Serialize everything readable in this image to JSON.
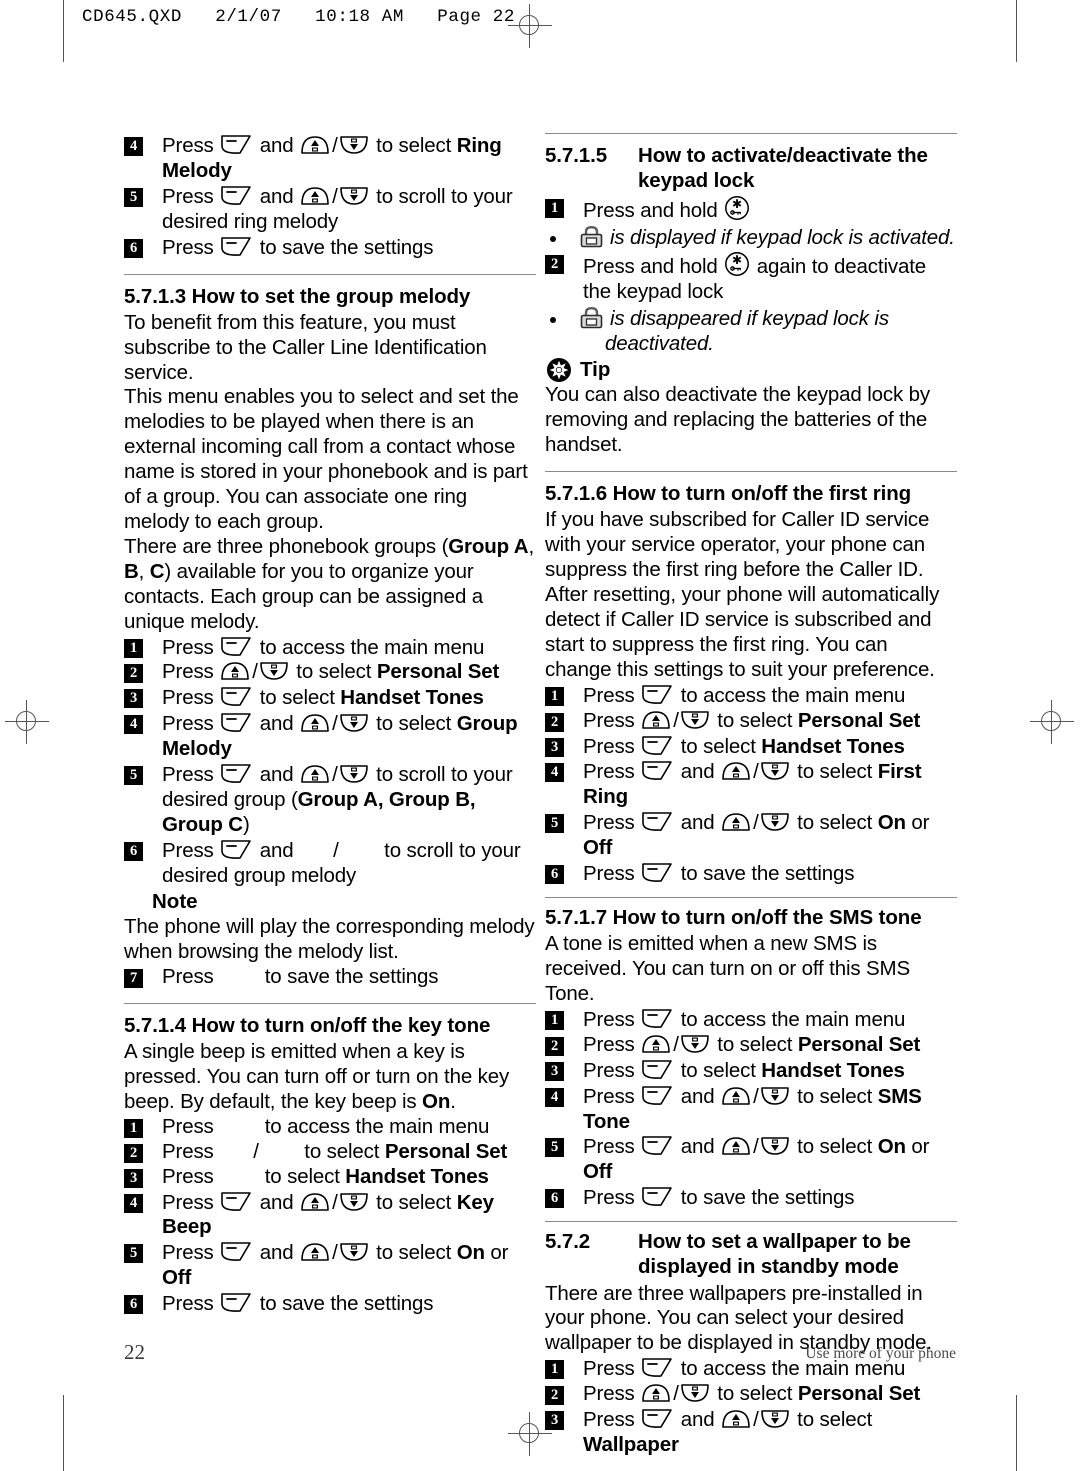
{
  "file_header": "CD645.QXD   2/1/07   10:18 AM   Page 22",
  "footer": {
    "page_number": "22",
    "running_title": "Use more of your phone"
  },
  "icons": {
    "softkey": "softkey-icon",
    "scroll_up": "scroll-up-icon",
    "scroll_down": "scroll-down-icon",
    "star_key": "star-key-icon",
    "padlock": "padlock-icon",
    "tip": "tip-asterisk-icon"
  },
  "left_column": {
    "ring_melody_steps": [
      {
        "num": "4",
        "parts": [
          {
            "t": "text",
            "v": "Press "
          },
          {
            "t": "icon",
            "v": "softkey"
          },
          {
            "t": "text",
            "v": " and "
          },
          {
            "t": "icon",
            "v": "scrollpair"
          },
          {
            "t": "text",
            "v": " to select "
          },
          {
            "t": "bold",
            "v": "Ring Melody"
          }
        ]
      },
      {
        "num": "5",
        "parts": [
          {
            "t": "text",
            "v": "Press "
          },
          {
            "t": "icon",
            "v": "softkey"
          },
          {
            "t": "text",
            "v": " and "
          },
          {
            "t": "icon",
            "v": "scrollpair"
          },
          {
            "t": "text",
            "v": " to scroll to your desired ring melody"
          }
        ]
      },
      {
        "num": "6",
        "parts": [
          {
            "t": "text",
            "v": "Press "
          },
          {
            "t": "icon",
            "v": "softkey"
          },
          {
            "t": "text",
            "v": " to save the settings"
          }
        ]
      }
    ],
    "section_5713": {
      "number": "5.7.1.3",
      "title": "How to set the group melody",
      "paragraphs": [
        "To benefit from this feature, you must subscribe to the Caller Line Identification service.",
        "This menu enables you to select and set the melodies to be played when there is an external incoming call from a contact whose name is stored in your phonebook and is part of a group. You can associate one ring melody to each group."
      ],
      "groups_intro_before": "There are three phonebook groups (",
      "groups_bold_1": "Group A",
      "groups_mid_1": ", ",
      "groups_bold_2": "B",
      "groups_mid_2": ", ",
      "groups_bold_3": "C",
      "groups_intro_after": ") available for you to organize your contacts. Each group can be assigned a unique melody.",
      "steps": [
        {
          "num": "1",
          "pre": "Press ",
          "icon": "softkey",
          "post": " to access the main menu",
          "bold": ""
        },
        {
          "num": "2",
          "pre": "Press ",
          "icon": "scrollpair",
          "post": " to select ",
          "bold": "Personal Set"
        },
        {
          "num": "3",
          "pre": "Press ",
          "icon": "softkey",
          "post": " to select ",
          "bold": "Handset Tones"
        },
        {
          "num": "4",
          "pre": "Press ",
          "icon": "softkey-and-scrollpair",
          "post": " to select ",
          "bold": "Group Melody"
        },
        {
          "num": "5",
          "pre": "Press ",
          "icon": "softkey-and-scrollpair",
          "post": " to scroll to your desired group (",
          "bold": "Group A, Group B, Group C",
          "tail": ")"
        },
        {
          "num": "6",
          "pre": "Press ",
          "icon": "softkey-and-missing",
          "post": " to scroll to your desired group melody",
          "bold": ""
        }
      ],
      "note_heading": "Note",
      "note_text": "The phone will play the corresponding melody when browsing the melody list.",
      "final_step": {
        "num": "7",
        "pre": "Press ",
        "icon": "missing",
        "post": " to save the settings"
      }
    },
    "section_5714": {
      "number": "5.7.1.4",
      "title": "How to turn on/off the key tone",
      "intro_a": "A single beep is emitted when a key is pressed. You can turn off or turn on the key beep. By default, the key beep is ",
      "intro_bold": "On",
      "intro_b": ".",
      "steps": [
        {
          "num": "1",
          "pre": "Press ",
          "icon": "missing",
          "post": " to access the main menu",
          "bold": ""
        },
        {
          "num": "2",
          "pre": "Press ",
          "icon": "missing-slash",
          "post": " to select ",
          "bold": "Personal Set"
        },
        {
          "num": "3",
          "pre": "Press ",
          "icon": "missing",
          "post": " to select ",
          "bold": "Handset Tones"
        },
        {
          "num": "4",
          "pre": "Press ",
          "icon": "softkey-and-scrollpair",
          "post": " to select ",
          "bold": "Key Beep"
        },
        {
          "num": "5",
          "pre": "Press ",
          "icon": "softkey-and-scrollpair",
          "post": " to select ",
          "bold": "On",
          "mid": " or ",
          "bold2": "Off"
        },
        {
          "num": "6",
          "pre": "Press ",
          "icon": "softkey",
          "post": " to save the settings",
          "bold": ""
        }
      ]
    }
  },
  "right_column": {
    "section_5715": {
      "number": "5.7.1.5",
      "title_line1": "How to activate/deactivate the",
      "title_line2": "keypad lock",
      "step1": {
        "num": "1",
        "pre": "Press and hold ",
        "icon": "star_key",
        "post": ""
      },
      "bullet1": "is displayed if keypad lock is activated.",
      "step2": {
        "num": "2",
        "pre": "Press and hold ",
        "icon": "star_key",
        "post": " again to deactivate the keypad lock"
      },
      "bullet2": "is disappeared if keypad lock is deactivated."
    },
    "tip": {
      "heading": "Tip",
      "text": "You can also deactivate the keypad lock by removing and replacing the batteries of the handset."
    },
    "section_5716": {
      "number": "5.7.1.6",
      "title": "How to turn on/off the first ring",
      "paragraph": "If you have subscribed for Caller ID service with your service operator, your phone can suppress the first ring before the Caller ID. After resetting, your phone will automatically detect if Caller ID service is subscribed and start to suppress the first ring. You can change this settings to suit your preference.",
      "steps": [
        {
          "num": "1",
          "pre": "Press ",
          "icon": "softkey",
          "post": " to access the main menu",
          "bold": ""
        },
        {
          "num": "2",
          "pre": "Press ",
          "icon": "scrollpair",
          "post": " to select ",
          "bold": "Personal Set"
        },
        {
          "num": "3",
          "pre": "Press ",
          "icon": "softkey",
          "post": " to select ",
          "bold": "Handset Tones"
        },
        {
          "num": "4",
          "pre": "Press ",
          "icon": "softkey-and-scrollpair",
          "post": " to select ",
          "bold": "First Ring"
        },
        {
          "num": "5",
          "pre": "Press ",
          "icon": "softkey-and-scrollpair",
          "post": " to select ",
          "bold": "On",
          "mid": " or ",
          "bold2": "Off"
        },
        {
          "num": "6",
          "pre": "Press ",
          "icon": "softkey",
          "post": " to save the settings",
          "bold": ""
        }
      ]
    },
    "section_5717": {
      "number": "5.7.1.7",
      "title_pre": "How to turn on/off the ",
      "title_bold": "SMS",
      "title_post": " tone",
      "paragraph": "A tone is emitted when a new SMS is received. You can turn on or off this SMS Tone.",
      "steps": [
        {
          "num": "1",
          "pre": "Press ",
          "icon": "softkey",
          "post": " to access the main menu",
          "bold": ""
        },
        {
          "num": "2",
          "pre": "Press ",
          "icon": "scrollpair",
          "post": " to select ",
          "bold": "Personal Set"
        },
        {
          "num": "3",
          "pre": "Press ",
          "icon": "softkey",
          "post": " to select ",
          "bold": "Handset Tones"
        },
        {
          "num": "4",
          "pre": "Press ",
          "icon": "softkey-and-scrollpair",
          "post": " to select ",
          "bold": "SMS Tone"
        },
        {
          "num": "5",
          "pre": "Press ",
          "icon": "softkey-and-scrollpair",
          "post": " to select ",
          "bold": "On",
          "mid": " or ",
          "bold2": "Off"
        },
        {
          "num": "6",
          "pre": "Press ",
          "icon": "softkey",
          "post": " to save the settings",
          "bold": ""
        }
      ]
    },
    "section_572": {
      "number": "5.7.2",
      "title_line1": "How to set a wallpaper to be",
      "title_line2": "displayed in standby mode",
      "paragraph": "There are three wallpapers pre-installed in your phone. You can select your desired wallpaper to be displayed in standby mode.",
      "steps": [
        {
          "num": "1",
          "pre": "Press ",
          "icon": "softkey",
          "post": " to access the main menu",
          "bold": ""
        },
        {
          "num": "2",
          "pre": "Press ",
          "icon": "scrollpair",
          "post": " to select ",
          "bold": "Personal Set"
        },
        {
          "num": "3",
          "pre": "Press ",
          "icon": "softkey-and-scrollpair",
          "post": " to select ",
          "bold": "Wallpaper"
        }
      ]
    }
  }
}
